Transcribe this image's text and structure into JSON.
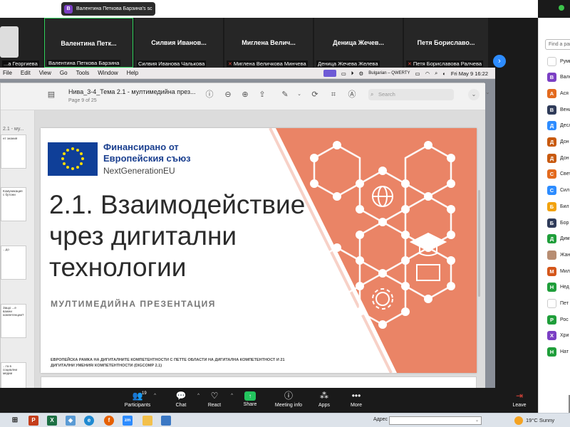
{
  "share_banner": {
    "initial": "В",
    "text": "Валентина Петкова Барзина's sc",
    "more": "•••"
  },
  "gallery": {
    "tiles": [
      {
        "big": "",
        "small": "...а Георгиева",
        "muted": false
      },
      {
        "big": "Валентина Петк...",
        "small": "Валентина Петкова Барзина",
        "muted": false
      },
      {
        "big": "Силвия Иванов...",
        "small": "Силвия Иванова Чалькова",
        "muted": false
      },
      {
        "big": "Миглена Велич...",
        "small": "Миглена Величкова Минчева",
        "muted": true
      },
      {
        "big": "Деница Жечев...",
        "small": "Деница Жечева Желева",
        "muted": false
      },
      {
        "big": "Петя Бориславо...",
        "small": "Петя Бориславова Ралчева",
        "muted": true
      }
    ],
    "next_icon": "chevron-right-icon"
  },
  "mac_menu": {
    "items": [
      "File",
      "Edit",
      "View",
      "Go",
      "Tools",
      "Window",
      "Help"
    ],
    "keyboard": "Bulgarian – QWERTY",
    "datetime": "Fri May 9  16:22"
  },
  "preview": {
    "title": "Нива_3-4_Тема 2.1 - мултимедийна през...",
    "page_info": "Page 9 of 25",
    "search_placeholder": "Search",
    "sidebar_label": "2.1 - му...",
    "thumbs": [
      {
        "text": "нт знания"
      },
      {
        "text": "Комуникация с бутони"
      },
      {
        "text": "...до"
      },
      {
        "text": "Защо ...е важни компетенции?"
      },
      {
        "text": "...та в социални медии"
      }
    ]
  },
  "slide": {
    "eu_line1": "Финансирано от",
    "eu_line2": "Европейския съюз",
    "eu_line3": "NextGenerationEU",
    "title": "2.1. Взаимодействие чрез дигитални технологии",
    "subtitle": "МУЛТИМЕДИЙНА ПРЕЗЕНТАЦИЯ",
    "footer": "ЕВРОПЕЙСКА РАМКА НА ДИГИТАЛНИТЕ КОМПЕТЕНТНОСТИ С ПЕТТЕ ОБЛАСТИ НА ДИГИТАЛНА КОМПЕТЕНТНОСТ И 21 ДИГИТАЛНИ УМЕНИЯ/ КОМПЕТЕНТНОСТИ (DIGCOMP 2.1)",
    "accent_color": "#ea8466"
  },
  "participants_panel": {
    "search_placeholder": "Find a participant",
    "items": [
      {
        "initial": "",
        "name": "Руми",
        "color": "#ffffff"
      },
      {
        "initial": "В",
        "name": "Вале",
        "color": "#7b3fc4"
      },
      {
        "initial": "А",
        "name": "Ася",
        "color": "#e36a1e"
      },
      {
        "initial": "В",
        "name": "Вени",
        "color": "#2f3b59"
      },
      {
        "initial": "Д",
        "name": "Десл",
        "color": "#2d8cff"
      },
      {
        "initial": "Д",
        "name": "Дон",
        "color": "#c85a10"
      },
      {
        "initial": "Д",
        "name": "Дон",
        "color": "#c85a10"
      },
      {
        "initial": "С",
        "name": "Свет",
        "color": "#e36a1e"
      },
      {
        "initial": "С",
        "name": "Сил",
        "color": "#2d8cff"
      },
      {
        "initial": "Б",
        "name": "Бил",
        "color": "#f2a20c"
      },
      {
        "initial": "Б",
        "name": "Бор",
        "color": "#2f3b59"
      },
      {
        "initial": "Д",
        "name": "Дим",
        "color": "#1f9e3a"
      },
      {
        "initial": "",
        "name": "Жан",
        "color": "#b78d72"
      },
      {
        "initial": "М",
        "name": "Мил",
        "color": "#d4561a"
      },
      {
        "initial": "Н",
        "name": "Нед",
        "color": "#1f9e3a"
      },
      {
        "initial": "",
        "name": "Пет",
        "color": "#ffffff"
      },
      {
        "initial": "Р",
        "name": "Рос",
        "color": "#1f9e3a"
      },
      {
        "initial": "Х",
        "name": "Хри",
        "color": "#7b3fc4"
      },
      {
        "initial": "Н",
        "name": "Нат",
        "color": "#1f9e3a"
      }
    ]
  },
  "controls": {
    "participants_count": "19",
    "participants": "Participants",
    "chat": "Chat",
    "react": "React",
    "share": "Share",
    "meeting_info": "Meeting info",
    "apps": "Apps",
    "more": "More",
    "leave": "Leave"
  },
  "taskbar": {
    "address_label": "Адрес",
    "weather": "19°C  Sunny",
    "icons": [
      "powerpoint-icon",
      "excel-icon",
      "copilot-icon",
      "edge-icon",
      "firefox-icon",
      "zoom-icon",
      "file-explorer-icon",
      "network-icon"
    ]
  }
}
